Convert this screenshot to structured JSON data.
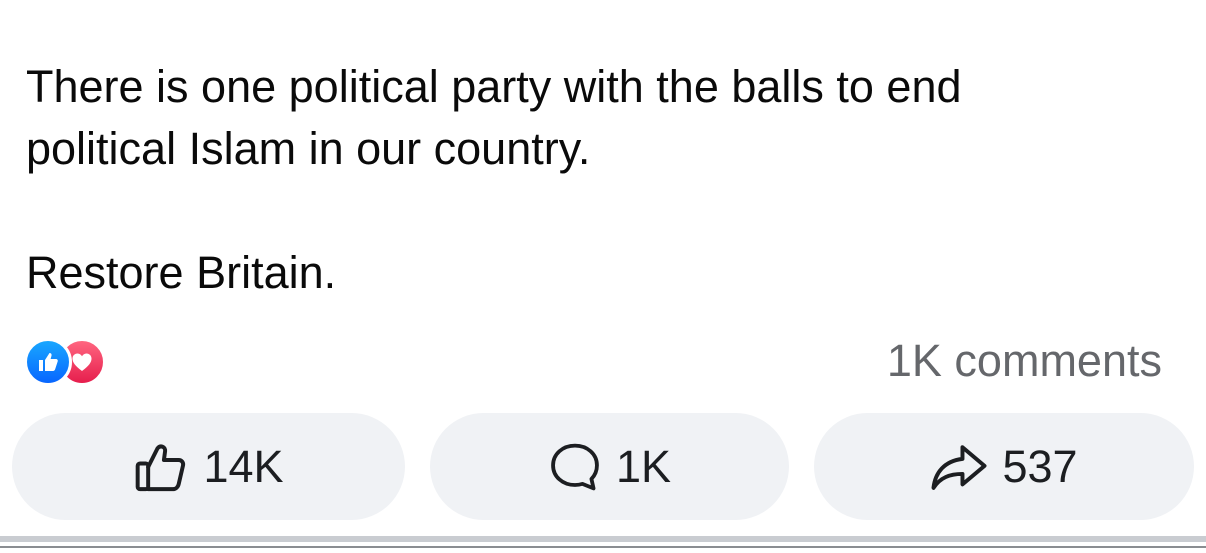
{
  "post": {
    "text_line_1": "There is one political party with the balls to end",
    "text_line_2": "political Islam in our country.",
    "text_line_3": "Restore Britain."
  },
  "reactions": {
    "icons": [
      "like-reaction-icon",
      "love-reaction-icon"
    ],
    "like_color": "#0866ff",
    "love_color": "#e61e4d"
  },
  "comments_summary": "1K comments",
  "actions": {
    "like_count": "14K",
    "comment_count": "1K",
    "share_count": "537"
  },
  "colors": {
    "pill_background": "#f0f2f5",
    "secondary_text": "#65676b"
  }
}
